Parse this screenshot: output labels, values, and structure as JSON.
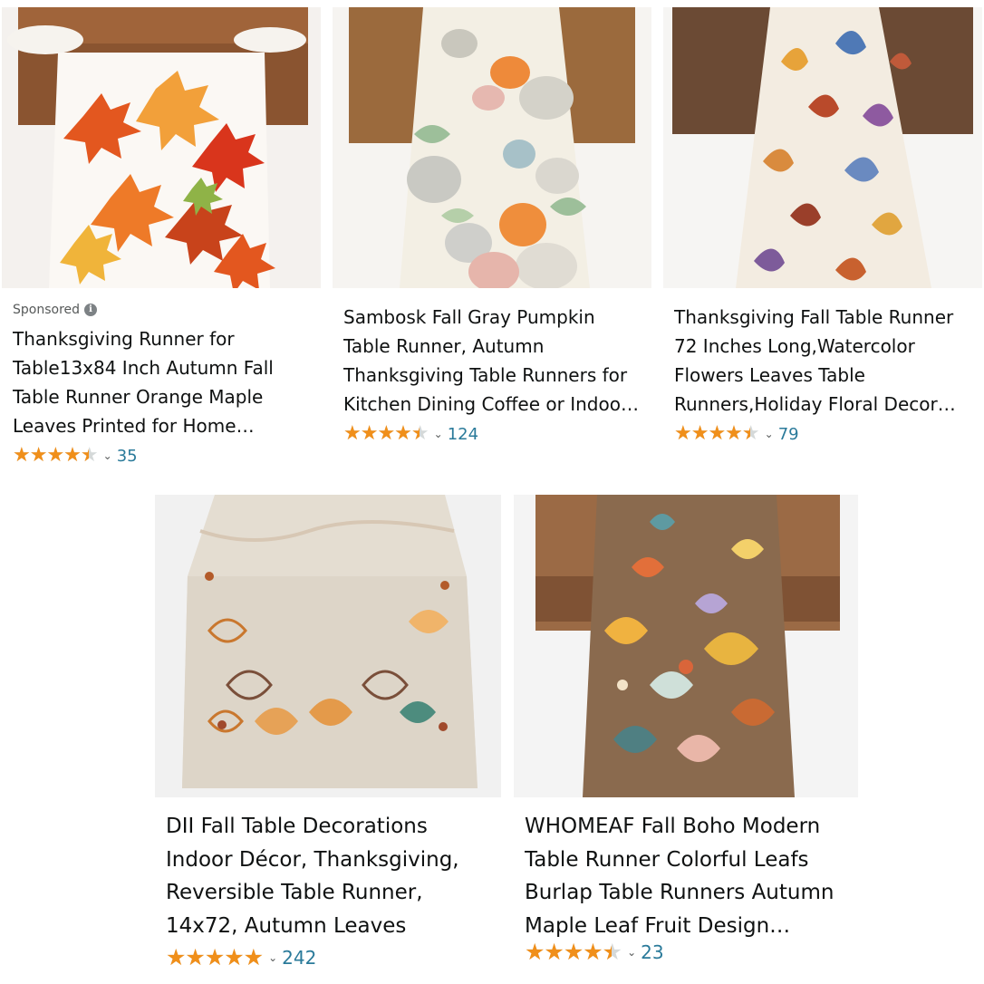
{
  "products": [
    {
      "sponsored_label": "Sponsored",
      "info_icon": "info-icon",
      "image_alt": "orange maple leaves table runner",
      "title": "Thanksgiving Runner for Table13x84 Inch Autumn Fall Table Runner Orange Maple Leaves Printed for Home Harves…",
      "rating_value": 4.5,
      "rating_count": "35"
    },
    {
      "image_alt": "gray pumpkin table runner",
      "title": "Sambosk Fall Gray Pumpkin Table Runner, Autumn Thanksgiving Table Runners for Kitchen Dining Coffee or Indoor and Outdoor…",
      "rating_value": 4.5,
      "rating_count": "124"
    },
    {
      "image_alt": "watercolor leaves table runner",
      "title": "Thanksgiving Fall Table Runner 72 Inches Long,Watercolor Flowers Leaves Table Runners,Holiday Floral Decor fo…",
      "rating_value": 4.5,
      "rating_count": "79"
    },
    {
      "image_alt": "embroidered autumn leaves table runner",
      "title": "DII Fall Table Decorations Indoor Décor, Thanksgiving, Reversible Table Runner, 14x72, Autumn Leaves",
      "rating_value": 5,
      "rating_count": "242"
    },
    {
      "image_alt": "boho colorful leafs burlap table runner",
      "title": "WHOMEAF Fall Boho Modern Table Runner Colorful Leafs Burlap Table Runners Autumn Maple Leaf Fruit Design Deco…",
      "rating_value": 4.5,
      "rating_count": "23"
    }
  ],
  "colors": {
    "star": "#f08f1a",
    "link": "#2a7a9a",
    "text": "#0f1111",
    "muted": "#565959"
  }
}
